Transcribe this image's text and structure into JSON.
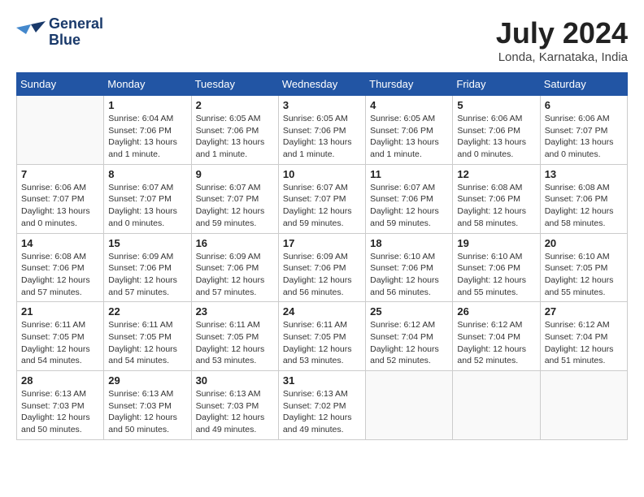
{
  "header": {
    "logo_line1": "General",
    "logo_line2": "Blue",
    "month_title": "July 2024",
    "location": "Londa, Karnataka, India"
  },
  "days_of_week": [
    "Sunday",
    "Monday",
    "Tuesday",
    "Wednesday",
    "Thursday",
    "Friday",
    "Saturday"
  ],
  "weeks": [
    [
      {
        "day": "",
        "info": ""
      },
      {
        "day": "1",
        "info": "Sunrise: 6:04 AM\nSunset: 7:06 PM\nDaylight: 13 hours\nand 1 minute."
      },
      {
        "day": "2",
        "info": "Sunrise: 6:05 AM\nSunset: 7:06 PM\nDaylight: 13 hours\nand 1 minute."
      },
      {
        "day": "3",
        "info": "Sunrise: 6:05 AM\nSunset: 7:06 PM\nDaylight: 13 hours\nand 1 minute."
      },
      {
        "day": "4",
        "info": "Sunrise: 6:05 AM\nSunset: 7:06 PM\nDaylight: 13 hours\nand 1 minute."
      },
      {
        "day": "5",
        "info": "Sunrise: 6:06 AM\nSunset: 7:06 PM\nDaylight: 13 hours\nand 0 minutes."
      },
      {
        "day": "6",
        "info": "Sunrise: 6:06 AM\nSunset: 7:07 PM\nDaylight: 13 hours\nand 0 minutes."
      }
    ],
    [
      {
        "day": "7",
        "info": "Sunrise: 6:06 AM\nSunset: 7:07 PM\nDaylight: 13 hours\nand 0 minutes."
      },
      {
        "day": "8",
        "info": "Sunrise: 6:07 AM\nSunset: 7:07 PM\nDaylight: 13 hours\nand 0 minutes."
      },
      {
        "day": "9",
        "info": "Sunrise: 6:07 AM\nSunset: 7:07 PM\nDaylight: 12 hours\nand 59 minutes."
      },
      {
        "day": "10",
        "info": "Sunrise: 6:07 AM\nSunset: 7:07 PM\nDaylight: 12 hours\nand 59 minutes."
      },
      {
        "day": "11",
        "info": "Sunrise: 6:07 AM\nSunset: 7:06 PM\nDaylight: 12 hours\nand 59 minutes."
      },
      {
        "day": "12",
        "info": "Sunrise: 6:08 AM\nSunset: 7:06 PM\nDaylight: 12 hours\nand 58 minutes."
      },
      {
        "day": "13",
        "info": "Sunrise: 6:08 AM\nSunset: 7:06 PM\nDaylight: 12 hours\nand 58 minutes."
      }
    ],
    [
      {
        "day": "14",
        "info": "Sunrise: 6:08 AM\nSunset: 7:06 PM\nDaylight: 12 hours\nand 57 minutes."
      },
      {
        "day": "15",
        "info": "Sunrise: 6:09 AM\nSunset: 7:06 PM\nDaylight: 12 hours\nand 57 minutes."
      },
      {
        "day": "16",
        "info": "Sunrise: 6:09 AM\nSunset: 7:06 PM\nDaylight: 12 hours\nand 57 minutes."
      },
      {
        "day": "17",
        "info": "Sunrise: 6:09 AM\nSunset: 7:06 PM\nDaylight: 12 hours\nand 56 minutes."
      },
      {
        "day": "18",
        "info": "Sunrise: 6:10 AM\nSunset: 7:06 PM\nDaylight: 12 hours\nand 56 minutes."
      },
      {
        "day": "19",
        "info": "Sunrise: 6:10 AM\nSunset: 7:06 PM\nDaylight: 12 hours\nand 55 minutes."
      },
      {
        "day": "20",
        "info": "Sunrise: 6:10 AM\nSunset: 7:05 PM\nDaylight: 12 hours\nand 55 minutes."
      }
    ],
    [
      {
        "day": "21",
        "info": "Sunrise: 6:11 AM\nSunset: 7:05 PM\nDaylight: 12 hours\nand 54 minutes."
      },
      {
        "day": "22",
        "info": "Sunrise: 6:11 AM\nSunset: 7:05 PM\nDaylight: 12 hours\nand 54 minutes."
      },
      {
        "day": "23",
        "info": "Sunrise: 6:11 AM\nSunset: 7:05 PM\nDaylight: 12 hours\nand 53 minutes."
      },
      {
        "day": "24",
        "info": "Sunrise: 6:11 AM\nSunset: 7:05 PM\nDaylight: 12 hours\nand 53 minutes."
      },
      {
        "day": "25",
        "info": "Sunrise: 6:12 AM\nSunset: 7:04 PM\nDaylight: 12 hours\nand 52 minutes."
      },
      {
        "day": "26",
        "info": "Sunrise: 6:12 AM\nSunset: 7:04 PM\nDaylight: 12 hours\nand 52 minutes."
      },
      {
        "day": "27",
        "info": "Sunrise: 6:12 AM\nSunset: 7:04 PM\nDaylight: 12 hours\nand 51 minutes."
      }
    ],
    [
      {
        "day": "28",
        "info": "Sunrise: 6:13 AM\nSunset: 7:03 PM\nDaylight: 12 hours\nand 50 minutes."
      },
      {
        "day": "29",
        "info": "Sunrise: 6:13 AM\nSunset: 7:03 PM\nDaylight: 12 hours\nand 50 minutes."
      },
      {
        "day": "30",
        "info": "Sunrise: 6:13 AM\nSunset: 7:03 PM\nDaylight: 12 hours\nand 49 minutes."
      },
      {
        "day": "31",
        "info": "Sunrise: 6:13 AM\nSunset: 7:02 PM\nDaylight: 12 hours\nand 49 minutes."
      },
      {
        "day": "",
        "info": ""
      },
      {
        "day": "",
        "info": ""
      },
      {
        "day": "",
        "info": ""
      }
    ]
  ]
}
